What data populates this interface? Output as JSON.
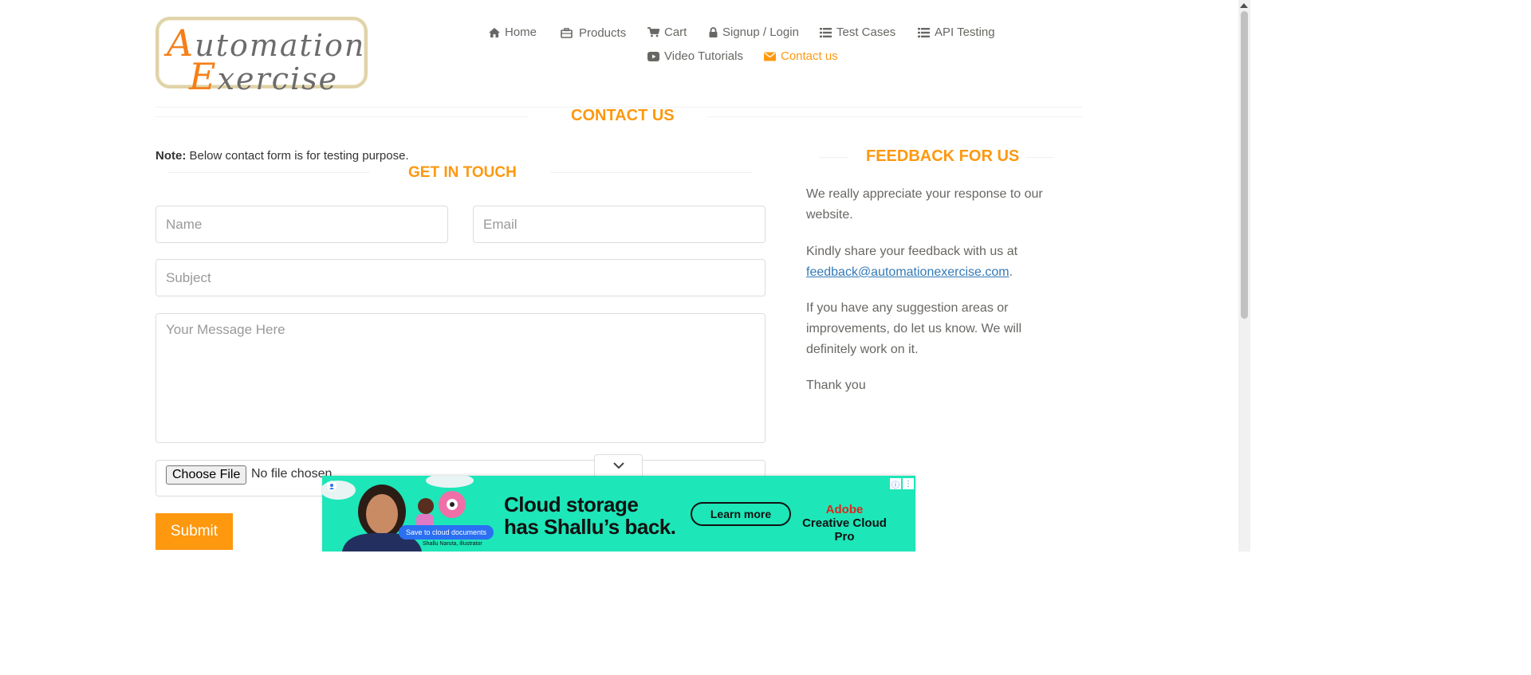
{
  "logo": {
    "line1": "utomation",
    "line1_cap": "A",
    "line2": "xercise",
    "line2_cap": "E"
  },
  "nav": {
    "home": "Home",
    "products": "Products",
    "cart": "Cart",
    "signup_login": "Signup / Login",
    "test_cases": "Test Cases",
    "api_testing": "API Testing",
    "video_tutorials": "Video Tutorials",
    "contact_us": "Contact us"
  },
  "page_title": "CONTACT US",
  "note": {
    "label": "Note:",
    "text": " Below contact form is for testing purpose."
  },
  "form": {
    "title": "GET IN TOUCH",
    "name_placeholder": "Name",
    "email_placeholder": "Email",
    "subject_placeholder": "Subject",
    "message_placeholder": "Your Message Here",
    "file_button": "Choose File",
    "file_status": "No file chosen",
    "submit_label": "Submit"
  },
  "feedback": {
    "title": "FEEDBACK FOR US",
    "p1": "We really appreciate your response to our website.",
    "p2_prefix": "Kindly share your feedback with us at ",
    "p2_email": "feedback@automationexercise.com",
    "p2_suffix": ".",
    "p3": "If you have any suggestion areas or improvements, do let us know. We will definitely work on it.",
    "p4": "Thank you"
  },
  "ad": {
    "headline_line1": "Cloud storage",
    "headline_line2": "has Shallu’s back.",
    "cta": "Learn more",
    "brand_line1": "Adobe",
    "brand_line2": "Creative Cloud Pro",
    "chip": "Save to cloud documents",
    "credit": "Shallu Naruta, illustrator",
    "bg_color": "#1de6b8"
  },
  "colors": {
    "accent": "#fe980f",
    "text": "#696763",
    "link": "#337ab7"
  },
  "icons": [
    "home-icon",
    "briefcase-icon",
    "cart-icon",
    "lock-icon",
    "list-icon",
    "youtube-icon",
    "envelope-icon",
    "chevron-down-icon"
  ]
}
